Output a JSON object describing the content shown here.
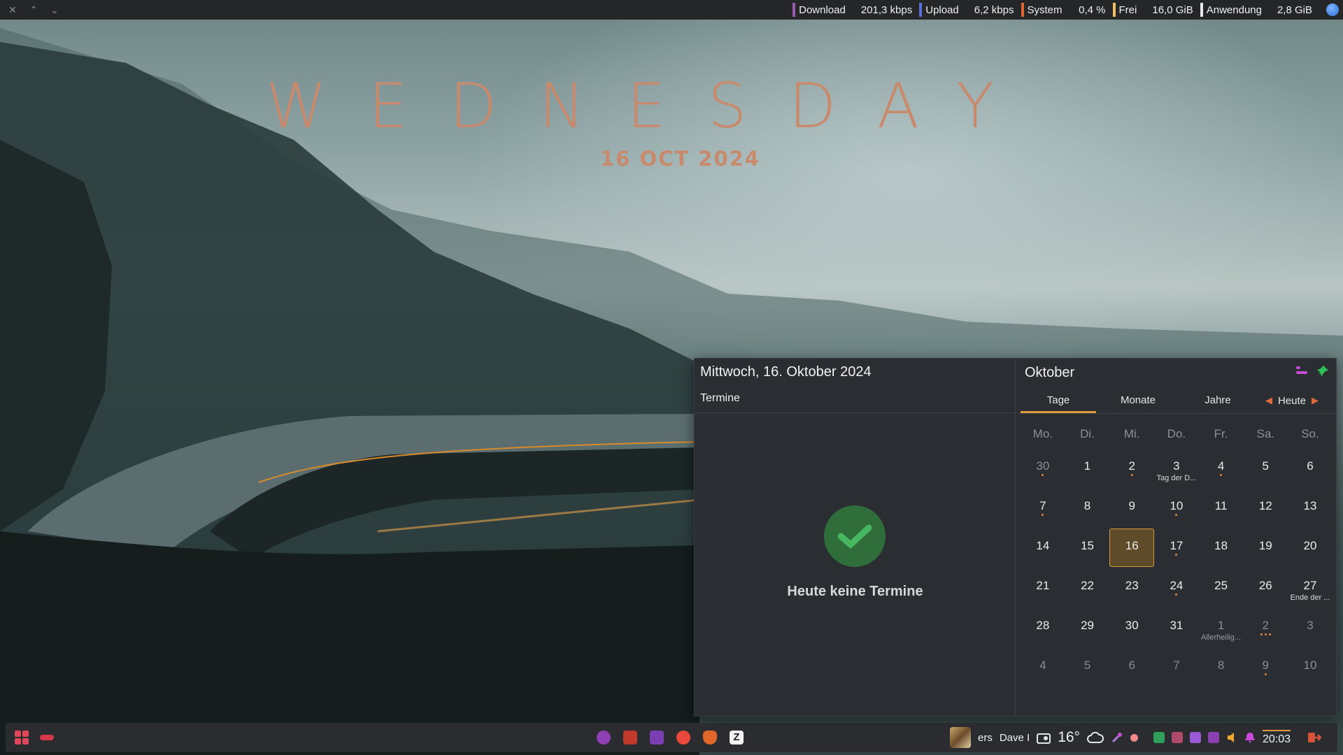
{
  "topbar": {
    "window_controls": [
      "close-icon",
      "chevron-up-icon",
      "chevron-down-icon"
    ],
    "monitors": [
      {
        "label": "Download",
        "value": "201,3 kbps",
        "color": "#9b59b6"
      },
      {
        "label": "Upload",
        "value": "6,2 kbps",
        "color": "#5b6fd6"
      },
      {
        "label": "System",
        "value": "0,4 %",
        "color": "#e0663a"
      },
      {
        "label": "Frei",
        "value": "16,0 GiB",
        "color": "#f0c060"
      },
      {
        "label": "Anwendung",
        "value": "2,8 GiB",
        "color": "#e8e8e8"
      }
    ],
    "tray_icon": "globe-icon"
  },
  "desktop": {
    "day_title": "WEDNESDAY",
    "date": "16 OCT 2024",
    "title_color": "#c88a6c"
  },
  "calendar": {
    "date_heading": "Mittwoch, 16. Oktober 2024",
    "events_label": "Termine",
    "no_events": "Heute keine Termine",
    "month_title": "Oktober",
    "tabs": [
      "Tage",
      "Monate",
      "Jahre"
    ],
    "active_tab": "Tage",
    "today_button": "Heute",
    "weekdays": [
      "Mo.",
      "Di.",
      "Mi.",
      "Do.",
      "Fr.",
      "Sa.",
      "So."
    ],
    "weeks": [
      [
        {
          "d": "30",
          "dim": true,
          "dots": 1
        },
        {
          "d": "1"
        },
        {
          "d": "2",
          "dots": 1
        },
        {
          "d": "3",
          "dots": 1,
          "sub": "Tag der D..."
        },
        {
          "d": "4",
          "dots": 1
        },
        {
          "d": "5"
        },
        {
          "d": "6"
        }
      ],
      [
        {
          "d": "7",
          "dots": 1
        },
        {
          "d": "8"
        },
        {
          "d": "9"
        },
        {
          "d": "10",
          "dots": 1
        },
        {
          "d": "11"
        },
        {
          "d": "12"
        },
        {
          "d": "13"
        }
      ],
      [
        {
          "d": "14"
        },
        {
          "d": "15"
        },
        {
          "d": "16",
          "today": true
        },
        {
          "d": "17",
          "dots": 1
        },
        {
          "d": "18"
        },
        {
          "d": "19"
        },
        {
          "d": "20"
        }
      ],
      [
        {
          "d": "21"
        },
        {
          "d": "22"
        },
        {
          "d": "23"
        },
        {
          "d": "24",
          "dots": 1
        },
        {
          "d": "25"
        },
        {
          "d": "26"
        },
        {
          "d": "27",
          "sub": "Ende der ..."
        }
      ],
      [
        {
          "d": "28"
        },
        {
          "d": "29"
        },
        {
          "d": "30"
        },
        {
          "d": "31"
        },
        {
          "d": "1",
          "dim": true,
          "dots": 2,
          "sub": "Allerheilig..."
        },
        {
          "d": "2",
          "dim": true,
          "dots": 3
        },
        {
          "d": "3",
          "dim": true
        }
      ],
      [
        {
          "d": "4",
          "dim": true
        },
        {
          "d": "5",
          "dim": true
        },
        {
          "d": "6",
          "dim": true
        },
        {
          "d": "7",
          "dim": true
        },
        {
          "d": "8",
          "dim": true
        },
        {
          "d": "9",
          "dim": true,
          "dots": 1
        },
        {
          "d": "10",
          "dim": true
        }
      ]
    ],
    "accent_color": "#e09a3c"
  },
  "panel": {
    "launchers": [
      "app-grid-icon",
      "toggle-icon"
    ],
    "tasks": [
      {
        "name": "settings-app-icon",
        "color": "#8e3fb3"
      },
      {
        "name": "files-app-icon",
        "color": "#c0392b"
      },
      {
        "name": "terminal-app-icon",
        "color": "#7b3fb3"
      },
      {
        "name": "firefox-app-icon",
        "color": "#e8493a"
      },
      {
        "name": "brave-app-icon",
        "color": "#e0662a"
      },
      {
        "name": "zed-app-icon",
        "color": "#f2f2f2"
      }
    ],
    "tray": {
      "media_text": "ers",
      "user_text": "Dave I",
      "temperature": "16°",
      "weather_icon": "cloud-icon",
      "clock": "20:03"
    }
  }
}
